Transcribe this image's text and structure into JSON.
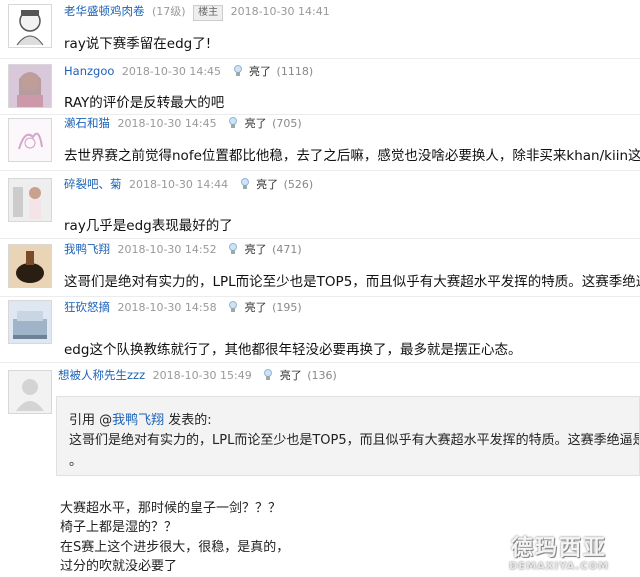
{
  "posts": [
    {
      "user": "老华盛顿鸡肉卷",
      "level": "(17级)",
      "tag": "楼主",
      "time": "2018-10-30 14:41",
      "text": "ray说下赛季留在edg了!"
    },
    {
      "user": "Hanzgoo",
      "time": "2018-10-30 14:45",
      "light_label": "亮了",
      "count": "(1118)",
      "text": "RAY的评价是反转最大的吧"
    },
    {
      "user": "濑石和猫",
      "time": "2018-10-30 14:45",
      "light_label": "亮了",
      "count": "(705)",
      "text": "去世界赛之前觉得nofe位置都比他稳，去了之后嘛，感觉也没啥必要换人，除非买来khan/kiin这种级别..."
    },
    {
      "user": "碎裂吧、菊",
      "time": "2018-10-30 14:44",
      "light_label": "亮了",
      "count": "(526)",
      "text": "ray几乎是edg表现最好的了"
    },
    {
      "user": "我鸭飞翔",
      "time": "2018-10-30 14:52",
      "light_label": "亮了",
      "count": "(471)",
      "text": "这哥们是绝对有实力的，LPL而论至少也是TOP5，而且似乎有大赛超水平发挥的特质。这赛季绝逼是被"
    },
    {
      "user": "狂砍怒摘",
      "time": "2018-10-30 14:58",
      "light_label": "亮了",
      "count": "(195)",
      "text": "edg这个队换教练就行了，其他都很年轻没必要再换了，最多就是摆正心态。"
    },
    {
      "user": "想被人称先生zzz",
      "time": "2018-10-30 15:49",
      "light_label": "亮了",
      "count": "(136)"
    }
  ],
  "quote": {
    "prefix": "引用 @",
    "user": "我鸭飞翔",
    "suffix": " 发表的:",
    "line1": "这哥们是绝对有实力的，LPL而论至少也是TOP5，而且似乎有大赛超水平发挥的特质。这赛季绝逼是被",
    "line2": "。"
  },
  "reply_lines": [
    "大赛超水平，那时候的皇子一剑？？？",
    "椅子上都是湿的？？",
    "在S赛上这个进步很大，很稳，是真的，",
    "过分的吹就没必要了"
  ],
  "watermark": {
    "title": "德玛西亚",
    "sub": "DEMAXIYA.COM"
  },
  "icons": [
    "bulb-icon"
  ]
}
